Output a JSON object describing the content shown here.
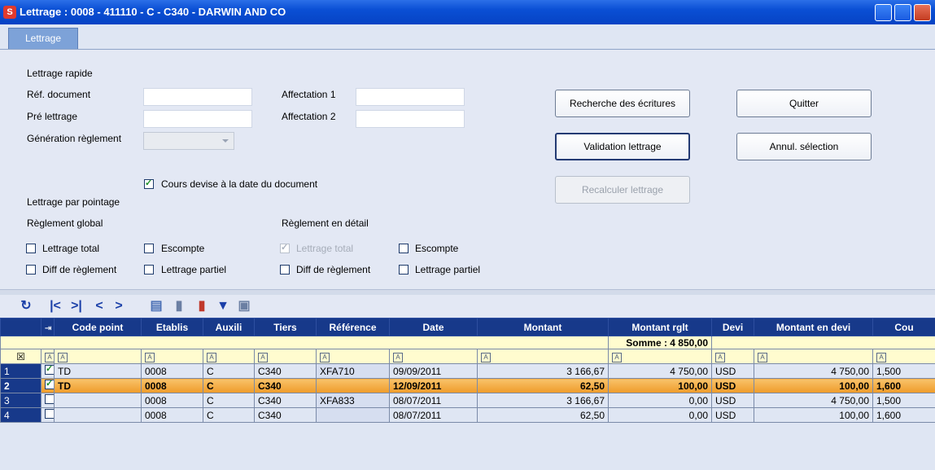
{
  "window": {
    "title": "Lettrage : 0008 - 411110 - C - C340 - DARWIN AND CO",
    "icon_glyph": "S"
  },
  "tabs": [
    {
      "label": "Lettrage"
    }
  ],
  "form": {
    "section_rapide": "Lettrage rapide",
    "ref_document_label": "Réf. document",
    "pre_lettrage_label": "Pré lettrage",
    "generation_reglement_label": "Génération règlement",
    "affectation1_label": "Affectation 1",
    "affectation2_label": "Affectation 2",
    "cours_devise_label": "Cours devise à la date du document",
    "section_pointage": "Lettrage par pointage",
    "reglement_global": "Règlement global",
    "reglement_detail": "Règlement en détail",
    "global_lettrage_total": "Lettrage total",
    "global_escompte": "Escompte",
    "global_diff_reglement": "Diff de règlement",
    "global_lettrage_partiel": "Lettrage partiel",
    "detail_lettrage_total": "Lettrage total",
    "detail_escompte": "Escompte",
    "detail_diff_reglement": "Diff de règlement",
    "detail_lettrage_partiel": "Lettrage partiel"
  },
  "buttons": {
    "recherche": "Recherche des écritures",
    "quitter": "Quitter",
    "validation": "Validation lettrage",
    "annul": "Annul. sélection",
    "recalculer": "Recalculer lettrage"
  },
  "grid": {
    "headers": [
      "Code point",
      "Etablis",
      "Auxili",
      "Tiers",
      "Référence",
      "Date",
      "Montant",
      "Montant rglt",
      "Devi",
      "Montant en devi",
      "Cou"
    ],
    "sum_label": "Somme : 4 850,00",
    "rows": [
      {
        "num": "1",
        "checked": true,
        "code": "TD",
        "etab": "0008",
        "aux": "C",
        "tiers": "C340",
        "ref": "XFA710",
        "date": "09/09/2011",
        "montant": "3 166,67",
        "rglt": "4 750,00",
        "devise": "USD",
        "mdevise": "4 750,00",
        "cours": "1,500"
      },
      {
        "num": "2",
        "checked": true,
        "code": "TD",
        "etab": "0008",
        "aux": "C",
        "tiers": "C340",
        "ref": "",
        "date": "12/09/2011",
        "montant": "62,50",
        "rglt": "100,00",
        "devise": "USD",
        "mdevise": "100,00",
        "cours": "1,600"
      },
      {
        "num": "3",
        "checked": false,
        "code": "",
        "etab": "0008",
        "aux": "C",
        "tiers": "C340",
        "ref": "XFA833",
        "date": "08/07/2011",
        "montant": "3 166,67",
        "rglt": "0,00",
        "devise": "USD",
        "mdevise": "4 750,00",
        "cours": "1,500"
      },
      {
        "num": "4",
        "checked": false,
        "code": "",
        "etab": "0008",
        "aux": "C",
        "tiers": "C340",
        "ref": "",
        "date": "08/07/2011",
        "montant": "62,50",
        "rglt": "0,00",
        "devise": "USD",
        "mdevise": "100,00",
        "cours": "1,600"
      }
    ]
  }
}
